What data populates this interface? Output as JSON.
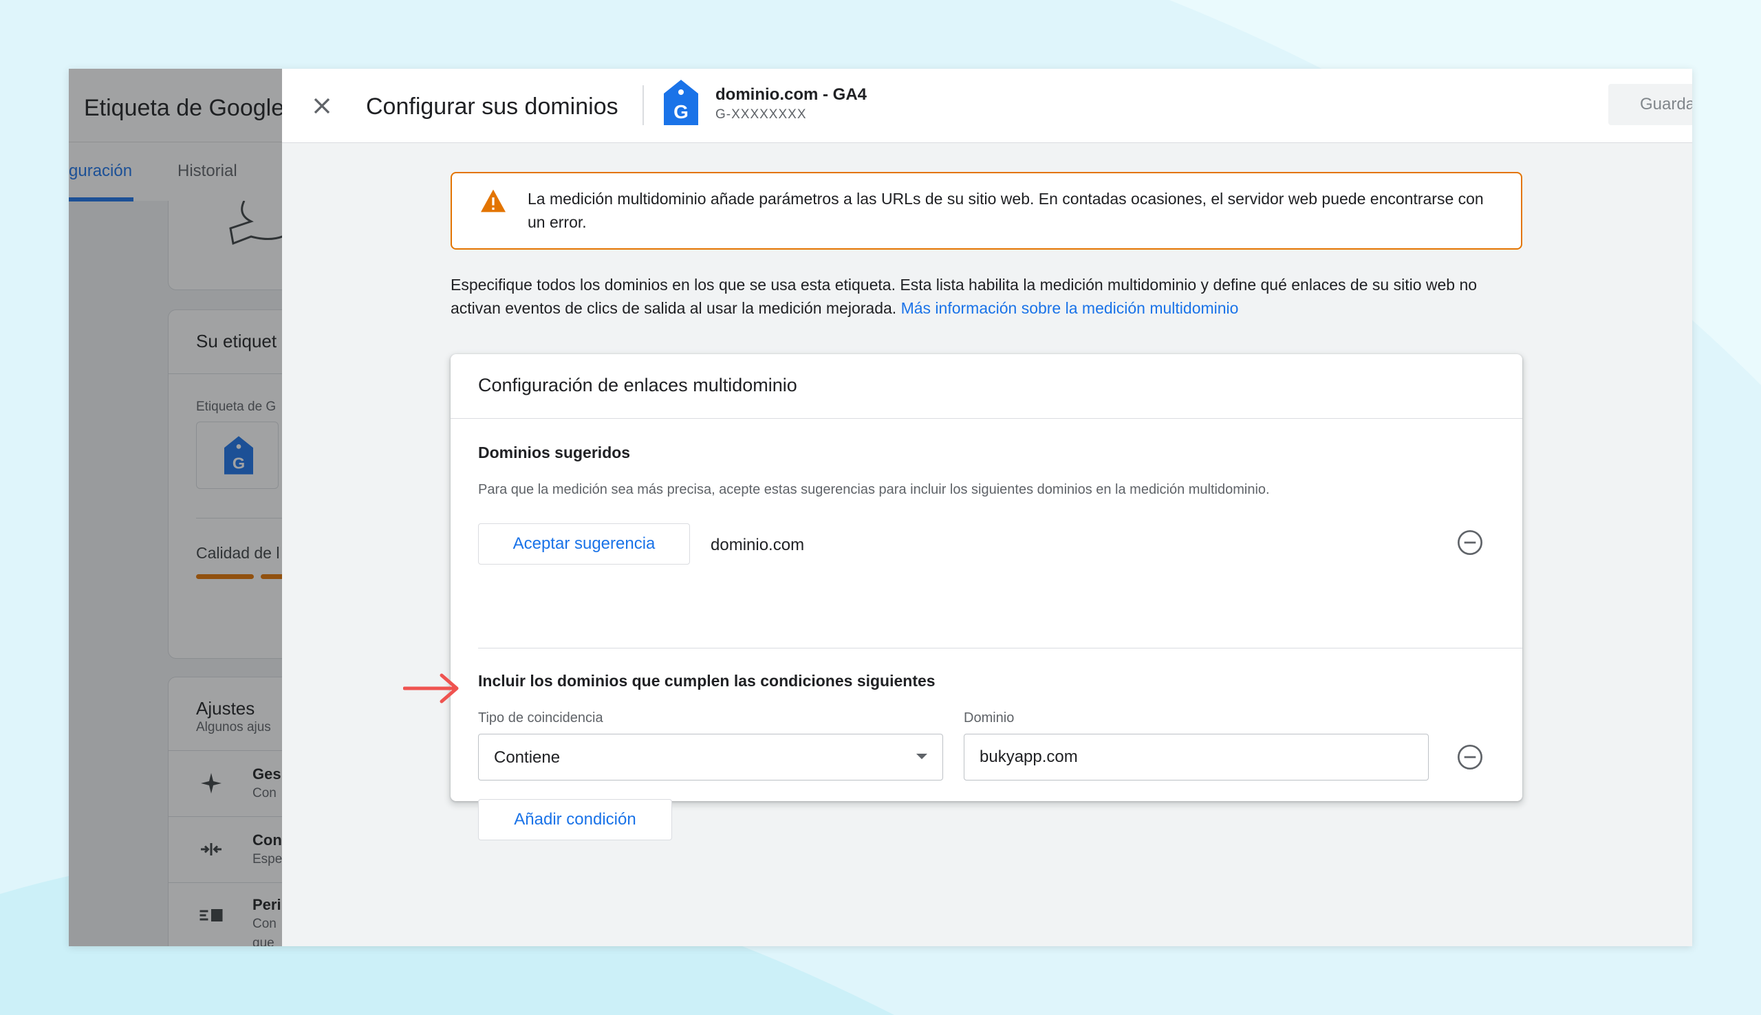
{
  "background_page": {
    "app_title": "Etiqueta de Google",
    "tabs": [
      {
        "label": "Configuración",
        "visible": "guración",
        "active": true
      },
      {
        "label": "Historial",
        "active": false
      }
    ],
    "cards": {
      "tag_card_title": "Su etiquet",
      "tag_label": "Etiqueta de G",
      "quality_label": "Calidad de l",
      "settings_title": "Ajustes",
      "settings_subtitle": "Algunos ajus",
      "settings_items": [
        {
          "title": "Ges",
          "desc": "Con"
        },
        {
          "title": "Con",
          "desc": "Espe"
        },
        {
          "title": "Peri",
          "desc": "Con",
          "desc2": "que"
        }
      ]
    }
  },
  "dialog": {
    "title": "Configurar sus dominios",
    "property_name": "dominio.com - GA4",
    "property_id": "G-XXXXXXXX",
    "save_label": "Guardar",
    "warning_text": "La medición multidominio añade parámetros a las URLs de su sitio web. En contadas ocasiones, el servidor web puede encontrarse con un error.",
    "intro_text": "Especifique todos los dominios en los que se usa esta etiqueta. Esta lista habilita la medición multidominio y define qué enlaces de su sitio web no activan eventos de clics de salida al usar la medición mejorada.",
    "intro_link": "Más información sobre la medición multidominio",
    "card": {
      "title": "Configuración de enlaces multidominio",
      "suggested": {
        "title": "Dominios sugeridos",
        "description": "Para que la medición sea más precisa, acepte estas sugerencias para incluir los siguientes dominios en la medición multidominio.",
        "accept_label": "Aceptar sugerencia",
        "domain": "dominio.com"
      },
      "conditions": {
        "title": "Incluir los dominios que cumplen las condiciones siguientes",
        "match_type_label": "Tipo de coincidencia",
        "match_type_value": "Contiene",
        "domain_label": "Dominio",
        "domain_value": "bukyapp.com",
        "add_condition_label": "Añadir condición"
      }
    }
  },
  "colors": {
    "accent": "#1a73e8",
    "warning": "#e37400",
    "annotation_arrow": "#ef5350"
  }
}
